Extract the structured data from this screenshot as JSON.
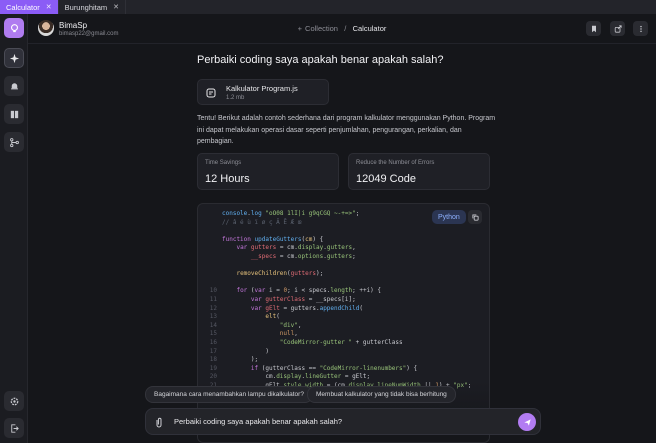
{
  "tabs": [
    {
      "label": "Calculator",
      "active": true
    },
    {
      "label": "Burunghitam",
      "active": false
    }
  ],
  "rail": {
    "items": [
      "logo-icon",
      "sparkle-icon",
      "bell-icon",
      "book-icon",
      "branch-icon"
    ],
    "bottom": [
      "settings-icon",
      "logout-icon"
    ]
  },
  "header": {
    "user_name": "BimaSp",
    "user_email": "bimasp22@gmail.com",
    "breadcrumb_parent": "Collection",
    "breadcrumb_separator": "/",
    "breadcrumb_current": "Calculator",
    "actions": [
      "bookmark-icon",
      "share-icon",
      "more-icon"
    ]
  },
  "chat": {
    "question": "Perbaiki coding saya apakah benar apakah salah?",
    "file": {
      "name": "Kalkulator Program.js",
      "size": "1.2 mb"
    },
    "answer": "Tentu! Berikut adalah contoh sederhana dari program kalkulator menggunakan Python. Program ini dapat melakukan operasi dasar seperti penjumlahan, pengurangan, perkalian, dan pembagian.",
    "stats": [
      {
        "label": "Time Savings",
        "value": "12 Hours"
      },
      {
        "label": "Reduce the Number of Errors",
        "value": "12049 Code"
      }
    ],
    "code_language": "Python"
  },
  "suggestions": [
    "Bagaimana cara menambahkan lampu dikalkulator?",
    "Membuat kalkulator yang tidak bisa berhitung"
  ],
  "composer": {
    "value": "Perbaiki coding saya apakah benar apakah salah?"
  },
  "colors": {
    "accent": "#8b5cf6",
    "send": "#b27cf2",
    "background": "#15161a"
  }
}
